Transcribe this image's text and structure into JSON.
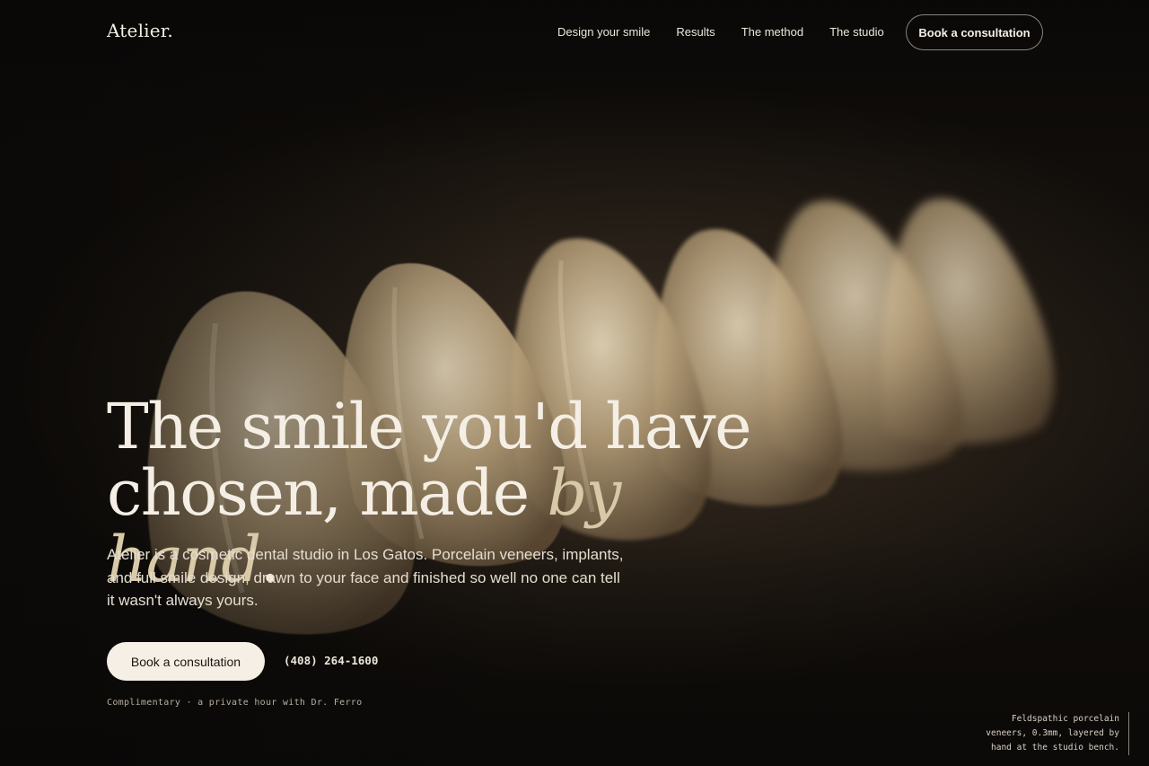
{
  "nav": {
    "logo": "Atelier.",
    "links": [
      "Design your smile",
      "Results",
      "The method",
      "The studio"
    ],
    "cta": "Book a consultation"
  },
  "hero": {
    "headline_line1": "The smile you'd have",
    "headline_line2_pre": "chosen, made ",
    "headline_accent": "by hand",
    "headline_end": ".",
    "lede": "Atelier is a cosmetic dental studio in Los Gatos. Porcelain veneers, implants, and full smile design, drawn to your face and finished so well no one can tell it wasn't always yours.",
    "primary_cta": "Book a consultation",
    "phone": "(408) 264-1600",
    "note": "Complimentary · a private hour with Dr. Ferro"
  },
  "image_caption": {
    "line1": "Feldspathic porcelain",
    "line2": "veneers, 0.3mm, layered by",
    "line3": "hand at the studio bench."
  },
  "colors": {
    "background": "#0c0a08",
    "text": "#f4eee4",
    "accent": "#d8c9a8",
    "button_fill": "#f5efe5"
  }
}
